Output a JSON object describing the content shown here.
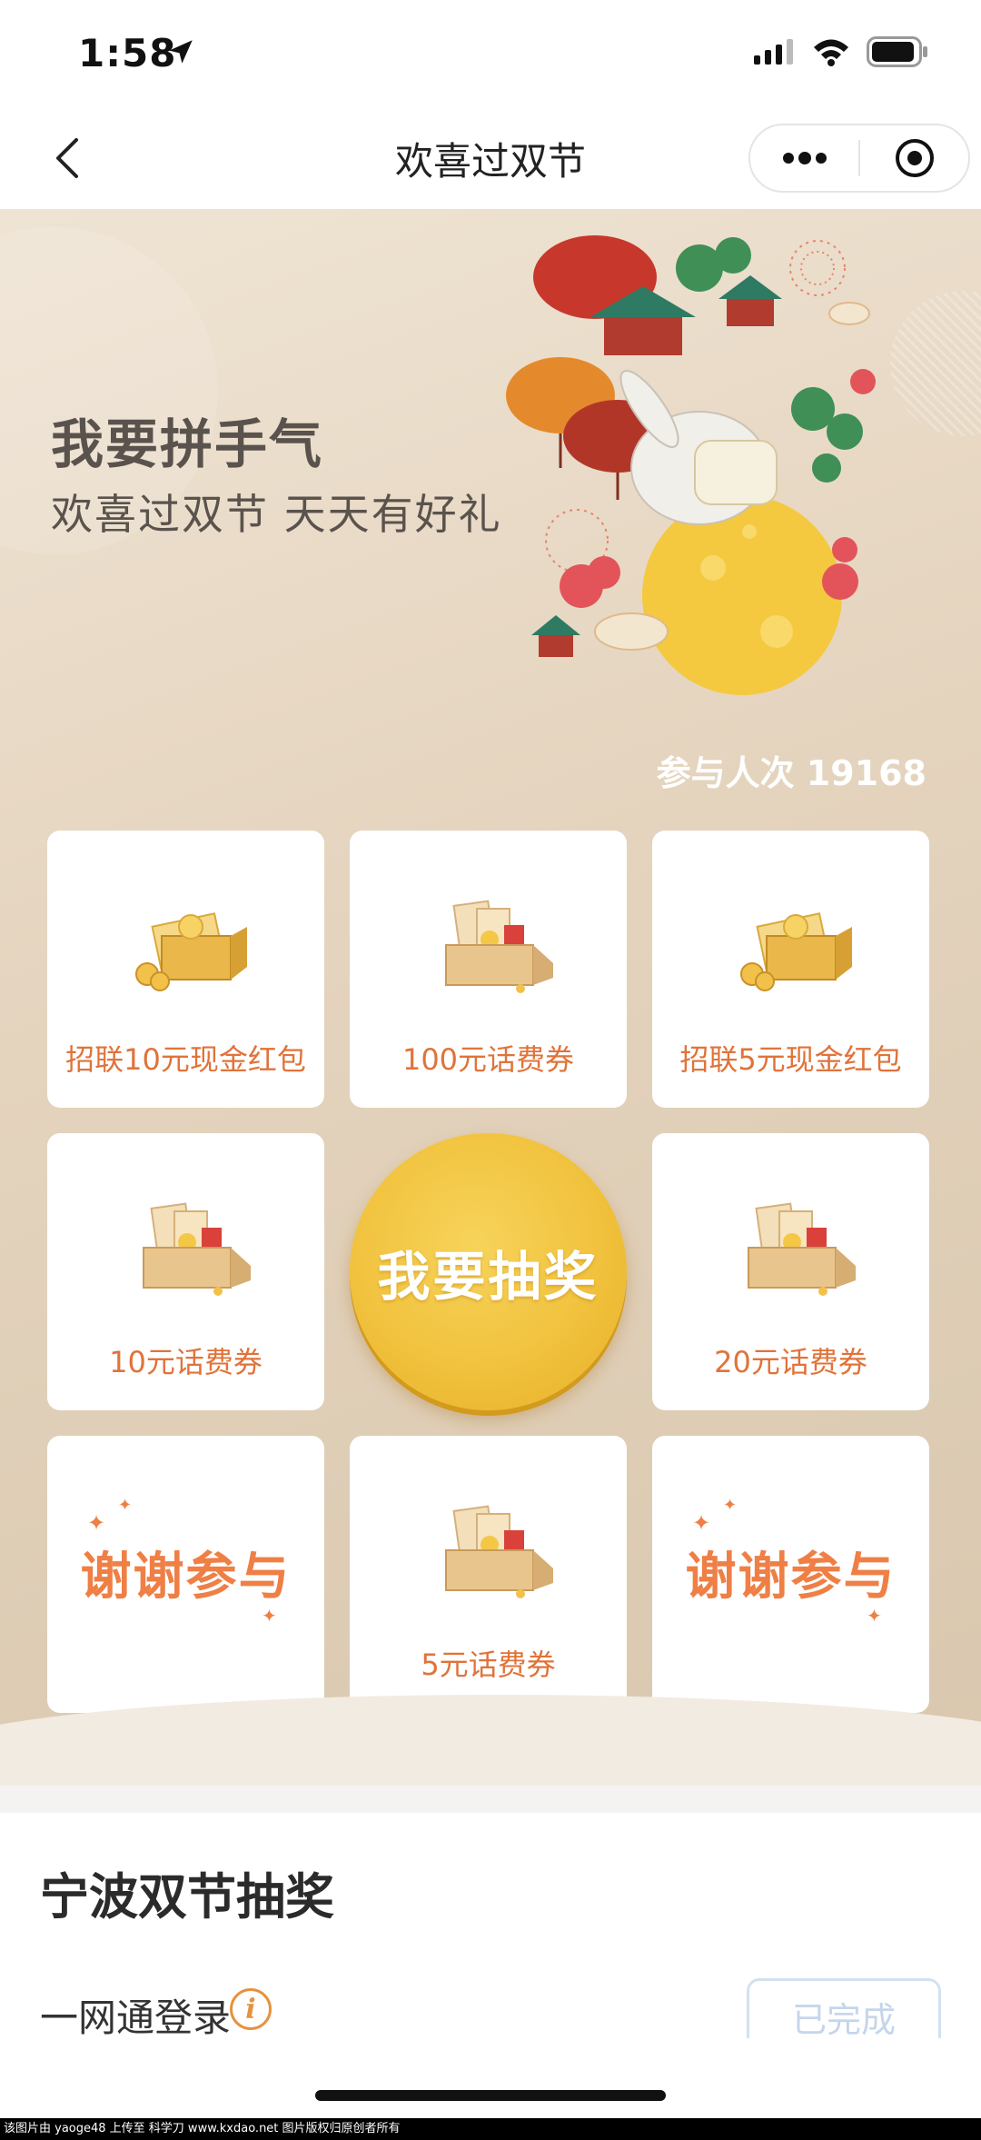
{
  "status_bar": {
    "time": "1:58"
  },
  "nav": {
    "title": "欢喜过双节"
  },
  "banner": {
    "title": "我要拼手气",
    "subtitle": "欢喜过双节 天天有好礼",
    "participation": "参与人次 19168"
  },
  "grid": {
    "cells": [
      {
        "label": "招联10元现金红包"
      },
      {
        "label": "100元话费券"
      },
      {
        "label": "招联5元现金红包"
      },
      {
        "label": "10元话费券"
      },
      {
        "label": "20元话费券"
      },
      {
        "label": "谢谢参与"
      },
      {
        "label": "5元话费券"
      },
      {
        "label": "谢谢参与"
      }
    ],
    "draw_button": "我要抽奖"
  },
  "section": {
    "title": "宁波双节抽奖",
    "task_label": "一网通登录",
    "task_button": "已完成"
  },
  "footer": {
    "watermark": "该图片由 yaoge48 上传至 科学刀 www.kxdao.net 图片版权归原创者所有"
  }
}
